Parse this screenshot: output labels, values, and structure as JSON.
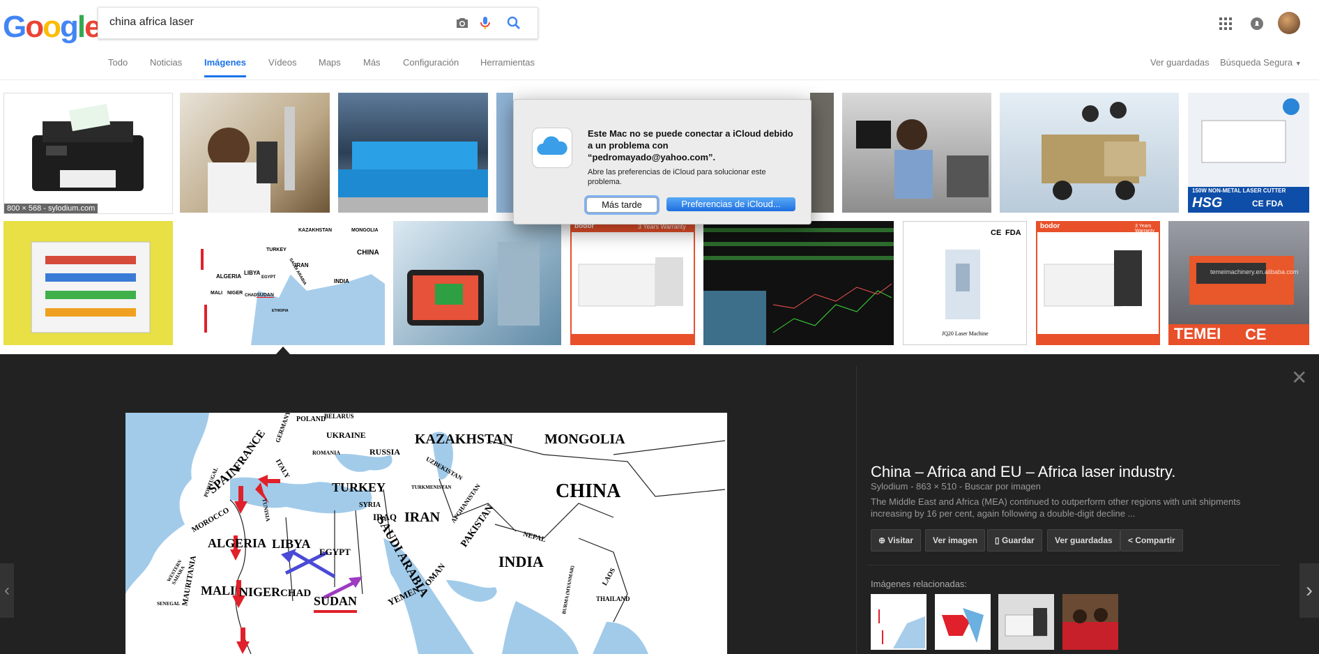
{
  "search": {
    "query": "china africa laser"
  },
  "logo": {
    "letters": [
      "G",
      "o",
      "o",
      "g",
      "l",
      "e"
    ],
    "colors": [
      "#4285f4",
      "#ea4335",
      "#fbbc05",
      "#4285f4",
      "#34a853",
      "#ea4335"
    ]
  },
  "tabs": [
    {
      "label": "Todo"
    },
    {
      "label": "Noticias"
    },
    {
      "label": "Imágenes"
    },
    {
      "label": "Vídeos"
    },
    {
      "label": "Maps"
    },
    {
      "label": "Más"
    },
    {
      "label": "Configuración"
    },
    {
      "label": "Herramientas"
    }
  ],
  "header_right": {
    "saved": "Ver guardadas",
    "safe_search": "Búsqueda Segura"
  },
  "thumbnails": {
    "first_caption": "800 × 568 - sylodium.com"
  },
  "dialog": {
    "title": "Este Mac no se puede conectar a iCloud debido a un problema con “pedromayado@yahoo.com”.",
    "body": "Abre las preferencias de iCloud para solucionar este problema.",
    "later": "Más tarde",
    "prefs": "Preferencias de iCloud..."
  },
  "detail": {
    "title": "China – Africa and EU – Africa laser industry.",
    "meta": "Sylodium - 863 × 510 - Buscar por imagen",
    "description": "The Middle East and Africa (MEA) continued to outperform other regions with unit shipments increasing by 16 per cent, again following a double-digit decline ...",
    "buttons": [
      "Visitar",
      "Ver imagen",
      "Guardar",
      "Ver guardadas",
      "Compartir"
    ],
    "related_label": "Imágenes relacionadas:"
  },
  "map_labels": {
    "kazakhstan": "KAZAKHSTAN",
    "mongolia": "MONGOLIA",
    "china": "CHINA",
    "russia": "RUSSIA",
    "ukraine": "UKRAINE",
    "poland": "POLAND",
    "belarus": "BELARUS",
    "turkey": "TURKEY",
    "iran": "IRAN",
    "iraq": "IRAQ",
    "syria": "SYRIA",
    "spain": "SPAIN",
    "france": "FRANCE",
    "italy": "ITALY",
    "morocco": "MOROCCO",
    "algeria": "ALGERIA",
    "libya": "LIBYA",
    "egypt": "EGYPT",
    "mali": "MALI",
    "niger": "NIGER",
    "chad": "CHAD",
    "sudan": "SUDAN",
    "saudi": "SAUDI ARABIA",
    "india": "INDIA",
    "pakistan": "PAKISTAN",
    "nepal": "NEPAL",
    "yemen": "YEMEN",
    "oman": "OMAN",
    "mauritania": "MAURITANIA",
    "uzbekistan": "UZBEKISTAN",
    "afghanistan": "AFGHANISTAN",
    "germany": "GERMANY",
    "romania": "ROMANIA",
    "tunisia": "TUNISIA",
    "portugal": "PORTUGAL",
    "laos": "LAOS",
    "thailand": "THAILAND",
    "senegal": "SENEGAL",
    "turkmenistan": "TURKMENISTAN",
    "wsahara": "WESTERN SAHARA",
    "myanmar": "BURMA (MYANMAR)"
  },
  "thumb_texts": {
    "hsg": "HSG",
    "warranty": "3 Years Warranty",
    "temei": "TEMEI",
    "ce": "CE",
    "fda": "FDA",
    "bodor": "bodor",
    "laser_cutter": "150W NON-METAL LASER CUTTER",
    "jq": "JQ20 Laser Machine",
    "watermark": "temeimachinery.en.alibaba.com",
    "china": "CHINA",
    "kazakhstan": "KAZAKHSTAN",
    "mongolia": "MONGOLIA",
    "turkey": "TURKEY",
    "iran": "IRAN",
    "india": "INDIA",
    "algeria": "ALGERIA",
    "libya": "LIBYA",
    "sudan": "SUDAN",
    "niger": "NIGER",
    "chad": "CHAD",
    "mali": "MALI",
    "egypt": "EGYPT",
    "ethiopia": "ETHIOPIA",
    "saudi": "SAUDI ARABIA"
  }
}
